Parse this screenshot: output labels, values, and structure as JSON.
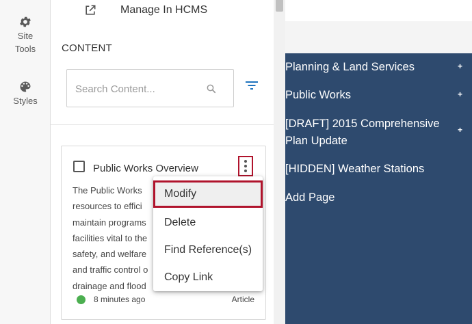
{
  "rail": {
    "site_tools_label": "Site\nTools",
    "styles_label": "Styles"
  },
  "panel": {
    "manage_label": "Manage In HCMS",
    "content_title": "CONTENT",
    "search": {
      "placeholder": "Search Content...",
      "value": ""
    }
  },
  "card": {
    "title": "Public Works Overview",
    "description_lines": [
      "The Public Works",
      "resources to effici",
      "maintain programs",
      "facilities vital to the",
      "safety, and welfare",
      "and traffic control o",
      "drainage and flood"
    ],
    "time": "8 minutes ago",
    "type": "Article",
    "status_color": "#4caf50"
  },
  "menu": {
    "items": [
      "Modify",
      "Delete",
      "Find Reference(s)",
      "Copy Link"
    ]
  },
  "nav": {
    "items": [
      {
        "label": "Planning & Land Services",
        "has_plus": true
      },
      {
        "label": "Public Works",
        "has_plus": true
      },
      {
        "label": "[DRAFT] 2015 Comprehensive Plan Update",
        "has_plus": true
      },
      {
        "label": "[HIDDEN] Weather Stations",
        "has_plus": false
      },
      {
        "label": "Add Page",
        "has_plus": false
      }
    ],
    "plus_symbol": "+"
  },
  "colors": {
    "nav_background": "#2e4a6e",
    "highlight_border": "#b0132c",
    "accent_blue": "#1e73be"
  },
  "icons": {
    "site_tools": "gear-icon",
    "styles": "palette-icon",
    "manage": "external-link-icon",
    "search": "search-icon",
    "filter": "filter-icon",
    "menu": "kebab-icon"
  }
}
